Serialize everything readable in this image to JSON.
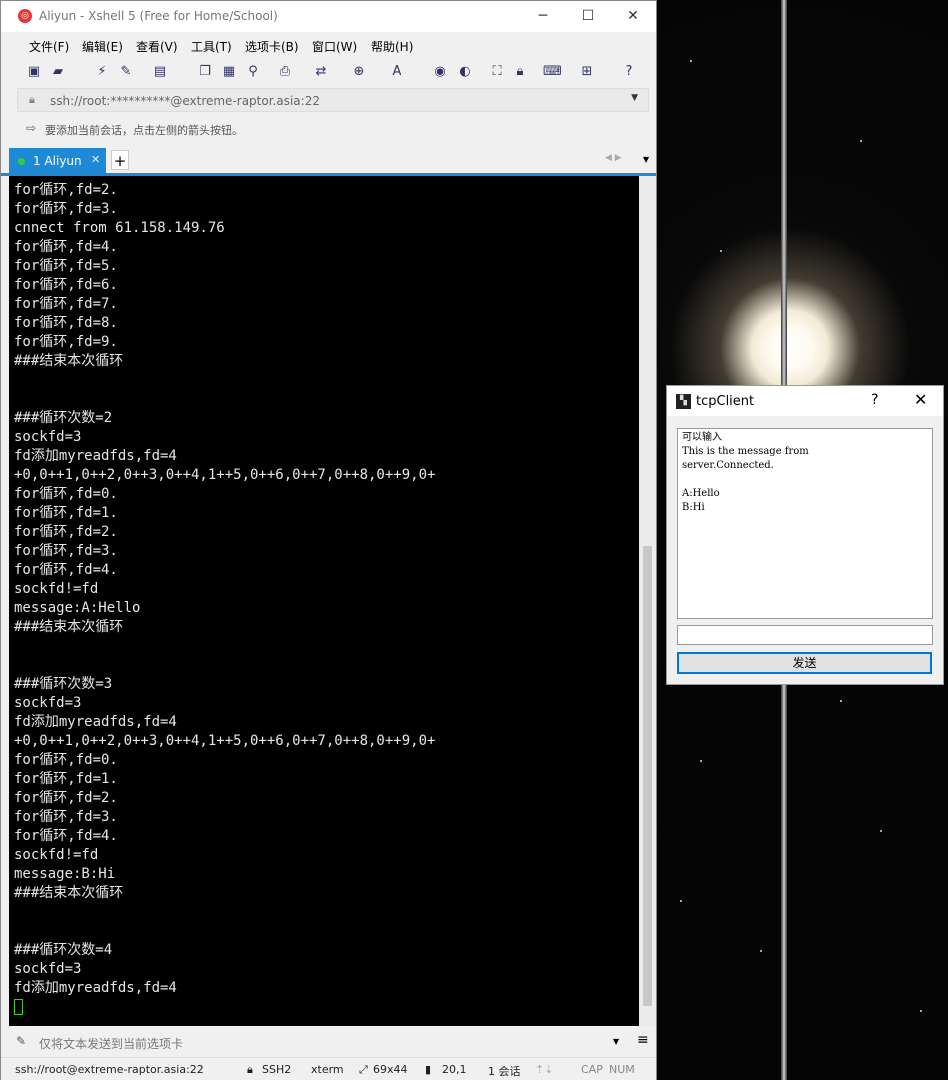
{
  "app": {
    "title": "Aliyun - Xshell 5 (Free for Home/School)",
    "icon": "xshell-logo-icon"
  },
  "menu": [
    "文件(F)",
    "编辑(E)",
    "查看(V)",
    "工具(T)",
    "选项卡(B)",
    "窗口(W)",
    "帮助(H)"
  ],
  "address": {
    "value": "ssh://root:**********@extreme-raptor.asia:22"
  },
  "info": {
    "text": "要添加当前会话，点击左侧的箭头按钮。"
  },
  "tab": {
    "label": "1 Aliyun",
    "add": "+"
  },
  "terminal": {
    "lines": [
      "for循环,fd=2.",
      "for循环,fd=3.",
      "cnnect from 61.158.149.76",
      "for循环,fd=4.",
      "for循环,fd=5.",
      "for循环,fd=6.",
      "for循环,fd=7.",
      "for循环,fd=8.",
      "for循环,fd=9.",
      "###结束本次循环",
      "",
      "",
      "###循环次数=2",
      "sockfd=3",
      "fd添加myreadfds,fd=4",
      "+0,0++1,0++2,0++3,0++4,1++5,0++6,0++7,0++8,0++9,0+",
      "for循环,fd=0.",
      "for循环,fd=1.",
      "for循环,fd=2.",
      "for循环,fd=3.",
      "for循环,fd=4.",
      "sockfd!=fd",
      "message:A:Hello",
      "###结束本次循环",
      "",
      "",
      "###循环次数=3",
      "sockfd=3",
      "fd添加myreadfds,fd=4",
      "+0,0++1,0++2,0++3,0++4,1++5,0++6,0++7,0++8,0++9,0+",
      "for循环,fd=0.",
      "for循环,fd=1.",
      "for循环,fd=2.",
      "for循环,fd=3.",
      "for循环,fd=4.",
      "sockfd!=fd",
      "message:B:Hi",
      "###结束本次循环",
      "",
      "",
      "###循环次数=4",
      "sockfd=3",
      "fd添加myreadfds,fd=4"
    ]
  },
  "sendbar": {
    "placeholder": "仅将文本发送到当前选项卡"
  },
  "status": {
    "connection": "ssh://root@extreme-raptor.asia:22",
    "protocol": "SSH2",
    "term": "xterm",
    "size": "69x44",
    "position": "20,1",
    "sessions": "1 会话",
    "cap": "CAP",
    "num": "NUM"
  },
  "dialog": {
    "title": "tcpClient",
    "help": "?",
    "close": "✕",
    "messages": [
      "可以输入",
      "This is the message from",
      "server.Connected.",
      "",
      "A:Hello",
      "B:Hi"
    ],
    "input_value": "",
    "send_label": "发送"
  }
}
